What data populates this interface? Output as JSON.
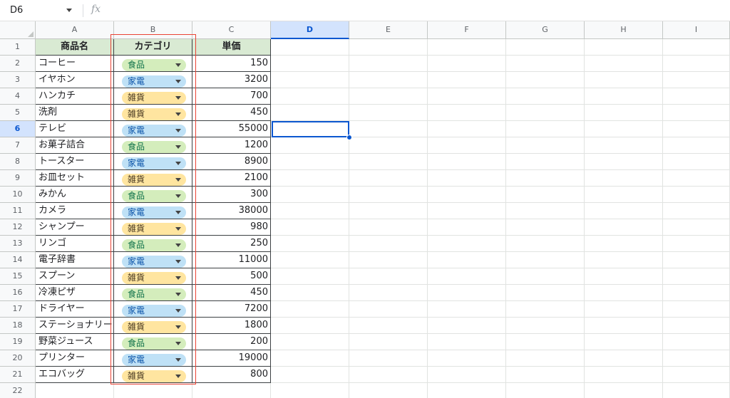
{
  "name_box": {
    "value": "D6"
  },
  "formula_bar": {
    "icon": "fx-icon",
    "fx_label": "fx"
  },
  "columns": [
    "A",
    "B",
    "C",
    "D",
    "E",
    "F",
    "G",
    "H",
    "I"
  ],
  "selected_column": "D",
  "selected_row": 6,
  "header_row": [
    "商品名",
    "カテゴリ",
    "単価"
  ],
  "rows": [
    {
      "name": "コーヒー",
      "category": "食品",
      "price": "150"
    },
    {
      "name": "イヤホン",
      "category": "家電",
      "price": "3200"
    },
    {
      "name": "ハンカチ",
      "category": "雑貨",
      "price": "700"
    },
    {
      "name": "洗剤",
      "category": "雑貨",
      "price": "450"
    },
    {
      "name": "テレビ",
      "category": "家電",
      "price": "55000"
    },
    {
      "name": "お菓子詰合",
      "category": "食品",
      "price": "1200"
    },
    {
      "name": "トースター",
      "category": "家電",
      "price": "8900"
    },
    {
      "name": "お皿セット",
      "category": "雑貨",
      "price": "2100"
    },
    {
      "name": "みかん",
      "category": "食品",
      "price": "300"
    },
    {
      "name": "カメラ",
      "category": "家電",
      "price": "38000"
    },
    {
      "name": "シャンプー",
      "category": "雑貨",
      "price": "980"
    },
    {
      "name": "リンゴ",
      "category": "食品",
      "price": "250"
    },
    {
      "name": "電子辞書",
      "category": "家電",
      "price": "11000"
    },
    {
      "name": "スプーン",
      "category": "雑貨",
      "price": "500"
    },
    {
      "name": "冷凍ピザ",
      "category": "食品",
      "price": "450"
    },
    {
      "name": "ドライヤー",
      "category": "家電",
      "price": "7200"
    },
    {
      "name": "ステーショナリー",
      "category": "雑貨",
      "price": "1800"
    },
    {
      "name": "野菜ジュース",
      "category": "食品",
      "price": "200"
    },
    {
      "name": "プリンター",
      "category": "家電",
      "price": "19000"
    },
    {
      "name": "エコバッグ",
      "category": "雑貨",
      "price": "800"
    }
  ],
  "total_rows": 22,
  "category_styles": {
    "食品": {
      "bg": "#d4edbc",
      "fg": "#11734b"
    },
    "家電": {
      "bg": "#bfe1f6",
      "fg": "#0a53a8"
    },
    "雑貨": {
      "bg": "#ffe5a0",
      "fg": "#473821"
    }
  },
  "colors": {
    "header_fill": "#d9ead3",
    "selection": "#0b57d0",
    "highlight_border": "#ea4335"
  }
}
